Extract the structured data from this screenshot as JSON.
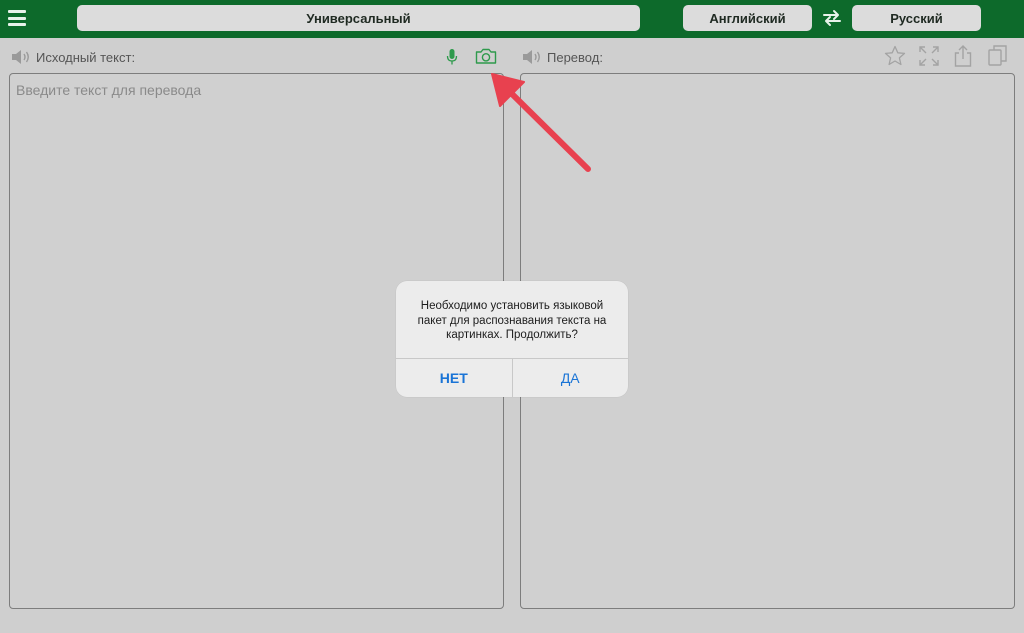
{
  "topbar": {
    "mode_label": "Универсальный",
    "source_lang": "Английский",
    "target_lang": "Русский",
    "icons": {
      "menu": "hamburger-icon",
      "swap": "swap-arrows-icon"
    }
  },
  "source": {
    "header": "Исходный текст:",
    "placeholder": "Введите текст для перевода",
    "value": "",
    "icons": [
      "speaker-icon",
      "microphone-icon",
      "camera-icon"
    ]
  },
  "translation": {
    "header": "Перевод:",
    "value": "",
    "icons": [
      "speaker-icon",
      "star-icon",
      "fullscreen-icon",
      "share-icon",
      "copy-icon"
    ]
  },
  "dialog": {
    "message": "Необходимо установить языковой пакет для распознавания текста на картинках. Продолжить?",
    "no_label": "НЕТ",
    "yes_label": "ДА"
  },
  "colors": {
    "topbar": "#0d6a2b",
    "accent_green": "#2e9a4c",
    "dialog_button": "#1a74d6",
    "annotation_arrow": "#e8414f"
  }
}
